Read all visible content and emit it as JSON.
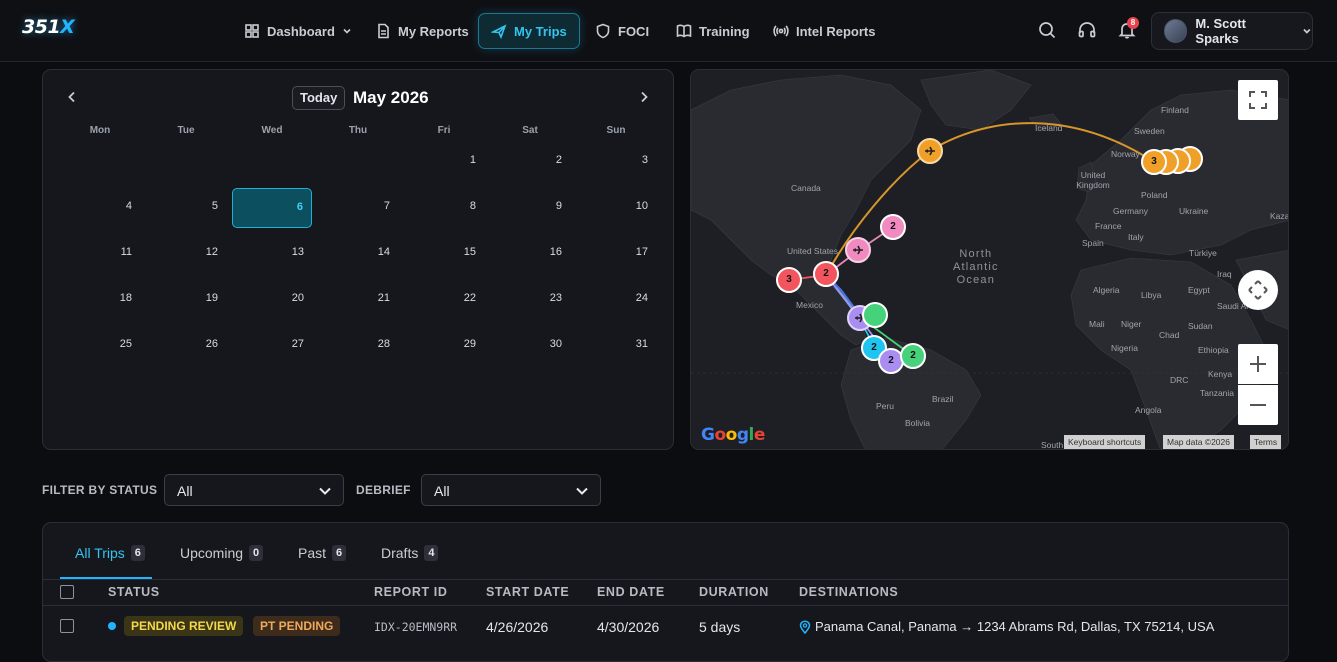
{
  "app": {
    "logo_main": "351",
    "logo_x": "X"
  },
  "nav": {
    "items": [
      {
        "label": "Dashboard",
        "icon": "dashboard-icon"
      },
      {
        "label": "My Reports",
        "icon": "report-icon"
      },
      {
        "label": "My Trips",
        "icon": "plane-icon",
        "active": true
      },
      {
        "label": "FOCI",
        "icon": "shield-icon"
      },
      {
        "label": "Training",
        "icon": "book-icon"
      },
      {
        "label": "Intel Reports",
        "icon": "radio-icon"
      }
    ],
    "notification_count": "8",
    "user_name": "M. Scott Sparks"
  },
  "calendar": {
    "today_label": "Today",
    "month_title": "May 2026",
    "weekdays": [
      "Mon",
      "Tue",
      "Wed",
      "Thu",
      "Fri",
      "Sat",
      "Sun"
    ],
    "selected_day": "6",
    "days": [
      "1",
      "2",
      "3",
      "4",
      "5",
      "6",
      "7",
      "8",
      "9",
      "10",
      "11",
      "12",
      "13",
      "14",
      "15",
      "16",
      "17",
      "18",
      "19",
      "20",
      "21",
      "22",
      "23",
      "24",
      "25",
      "26",
      "27",
      "28",
      "29",
      "30",
      "31"
    ]
  },
  "map": {
    "labels": [
      "Finland",
      "Sweden",
      "Norway",
      "Iceland",
      "United Kingdom",
      "Poland",
      "Germany",
      "Ukraine",
      "France",
      "Italy",
      "Spain",
      "Türkiye",
      "Iraq",
      "Kaza",
      "Canada",
      "United States",
      "Mexico",
      "Algeria",
      "Libya",
      "Egypt",
      "Saudi Ar",
      "Mali",
      "Niger",
      "Chad",
      "Sudan",
      "Nigeria",
      "Ethiopia",
      "DRC",
      "Kenya",
      "Tanzania",
      "Angola",
      "Brazil",
      "Peru",
      "Bolivia",
      "South"
    ],
    "ocean_label": "North\nAtlantic\nOcean",
    "markers": [
      {
        "label": "2",
        "color": "#f08ac0"
      },
      {
        "label": "3",
        "color": "#f2555d"
      },
      {
        "label": "2",
        "color": "#f2555d"
      },
      {
        "label": "2",
        "color": "#1ec5f0"
      },
      {
        "label": "2",
        "color": "#a98df0"
      },
      {
        "label": "2",
        "color": "#45d27a"
      },
      {
        "label": "3",
        "color": "#f0a028"
      }
    ],
    "keyboard_shortcuts": "Keyboard shortcuts",
    "map_data": "Map data ©2026",
    "terms": "Terms",
    "google": "Google"
  },
  "filters": {
    "status_label": "FILTER BY STATUS",
    "status_value": "All",
    "debrief_label": "DEBRIEF",
    "debrief_value": "All"
  },
  "tabs": [
    {
      "label": "All Trips",
      "count": "6",
      "active": true
    },
    {
      "label": "Upcoming",
      "count": "0"
    },
    {
      "label": "Past",
      "count": "6"
    },
    {
      "label": "Drafts",
      "count": "4"
    }
  ],
  "table": {
    "columns": [
      "STATUS",
      "REPORT ID",
      "START DATE",
      "END DATE",
      "DURATION",
      "DESTINATIONS"
    ],
    "rows": [
      {
        "badges": [
          "PENDING REVIEW",
          "PT PENDING"
        ],
        "report_id": "IDX-20EMN9RR",
        "start_date": "4/26/2026",
        "end_date": "4/30/2026",
        "duration": "5 days",
        "destinations": "Panama Canal, Panama → 1234 Abrams Rd, Dallas, TX 75214, USA"
      }
    ]
  },
  "colors": {
    "accent": "#1fb6ff",
    "badge_pending_review_bg": "#3a3517",
    "badge_pending_review_fg": "#f5d84a",
    "badge_pt_pending_bg": "#3d2c1c",
    "badge_pt_pending_fg": "#f0a95a"
  }
}
